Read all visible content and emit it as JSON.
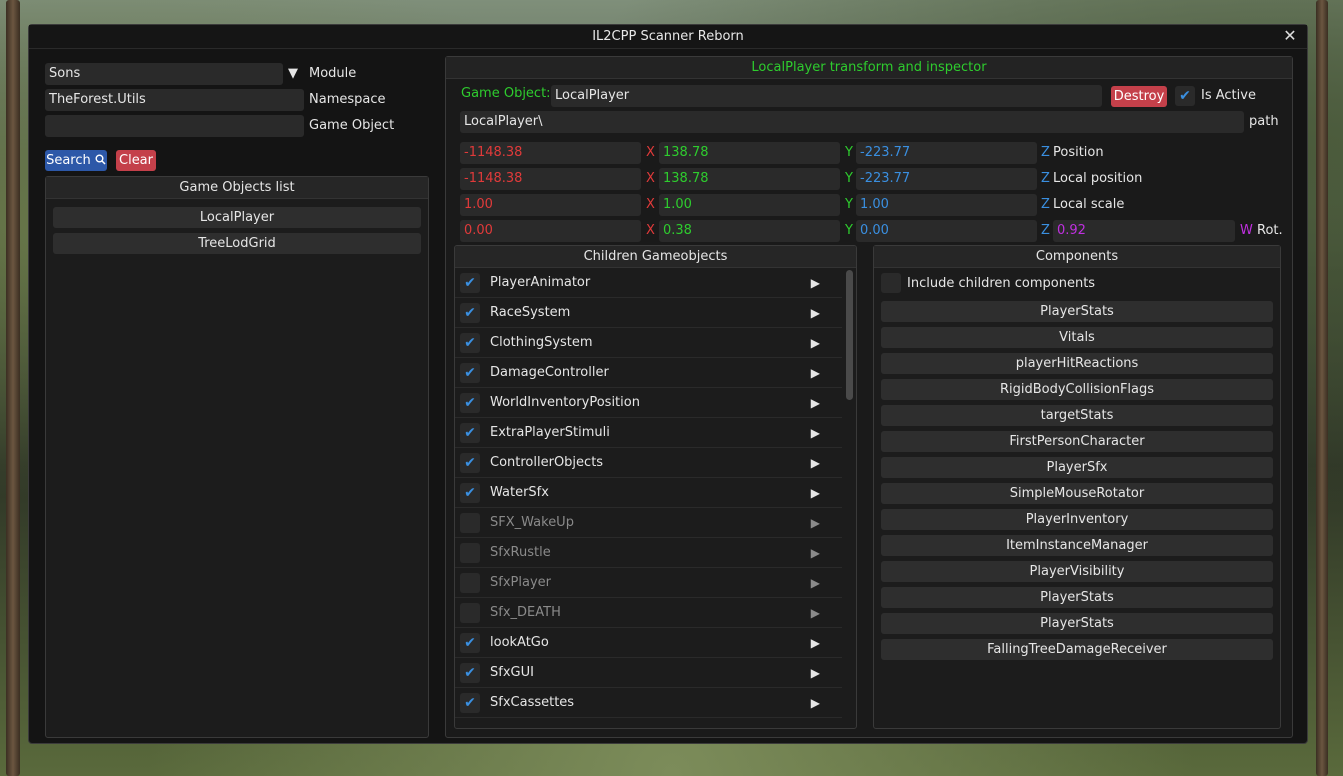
{
  "window": {
    "title": "IL2CPP Scanner Reborn",
    "close_glyph": "✕"
  },
  "search": {
    "module_value": "Sons",
    "module_label": "Module",
    "namespace_value": "TheForest.Utils",
    "namespace_label": "Namespace",
    "game_object_value": "",
    "game_object_label": "Game Object",
    "search_button": "Search",
    "clear_button": "Clear"
  },
  "objects_list": {
    "header": "Game Objects list",
    "items": [
      "LocalPlayer",
      "TreeLodGrid"
    ]
  },
  "inspector": {
    "header": "LocalPlayer transform and inspector",
    "game_object_label": "Game Object:",
    "game_object_value": "LocalPlayer",
    "destroy_button": "Destroy",
    "is_active_label": "Is Active",
    "is_active": true,
    "path_value": "LocalPlayer\\",
    "path_label": "path",
    "axis_x": "X",
    "axis_y": "Y",
    "axis_z": "Z",
    "axis_w": "W",
    "position": {
      "x": "-1148.38",
      "y": "138.78",
      "z": "-223.77",
      "label": "Position"
    },
    "local_position": {
      "x": "-1148.38",
      "y": "138.78",
      "z": "-223.77",
      "label": "Local position"
    },
    "local_scale": {
      "x": "1.00",
      "y": "1.00",
      "z": "1.00",
      "label": "Local scale"
    },
    "rotation": {
      "x": "0.00",
      "y": "0.38",
      "z": "0.00",
      "w": "0.92",
      "label": "Rot."
    }
  },
  "children": {
    "header": "Children Gameobjects",
    "items": [
      {
        "name": "PlayerAnimator",
        "active": true
      },
      {
        "name": "RaceSystem",
        "active": true
      },
      {
        "name": "ClothingSystem",
        "active": true
      },
      {
        "name": "DamageController",
        "active": true
      },
      {
        "name": "WorldInventoryPosition",
        "active": true
      },
      {
        "name": "ExtraPlayerStimuli",
        "active": true
      },
      {
        "name": "ControllerObjects",
        "active": true
      },
      {
        "name": "WaterSfx",
        "active": true
      },
      {
        "name": "SFX_WakeUp",
        "active": false
      },
      {
        "name": "SfxRustle",
        "active": false
      },
      {
        "name": "SfxPlayer",
        "active": false
      },
      {
        "name": "Sfx_DEATH",
        "active": false
      },
      {
        "name": "lookAtGo",
        "active": true
      },
      {
        "name": "SfxGUI",
        "active": true
      },
      {
        "name": "SfxCassettes",
        "active": true
      }
    ]
  },
  "components": {
    "header": "Components",
    "include_children_label": "Include children components",
    "include_children": false,
    "items": [
      "PlayerStats",
      "Vitals",
      "playerHitReactions",
      "RigidBodyCollisionFlags",
      "targetStats",
      "FirstPersonCharacter",
      "PlayerSfx",
      "SimpleMouseRotator",
      "PlayerInventory",
      "ItemInstanceManager",
      "PlayerVisibility",
      "PlayerStats",
      "PlayerStats",
      "FallingTreeDamageReceiver"
    ]
  },
  "colors": {
    "accent_green": "#2ecc2e",
    "axis_red": "#e03a3a",
    "axis_blue": "#3a8fe0",
    "axis_purple": "#c030e0",
    "button_blue": "#2d58a8",
    "button_red": "#c4404a"
  }
}
